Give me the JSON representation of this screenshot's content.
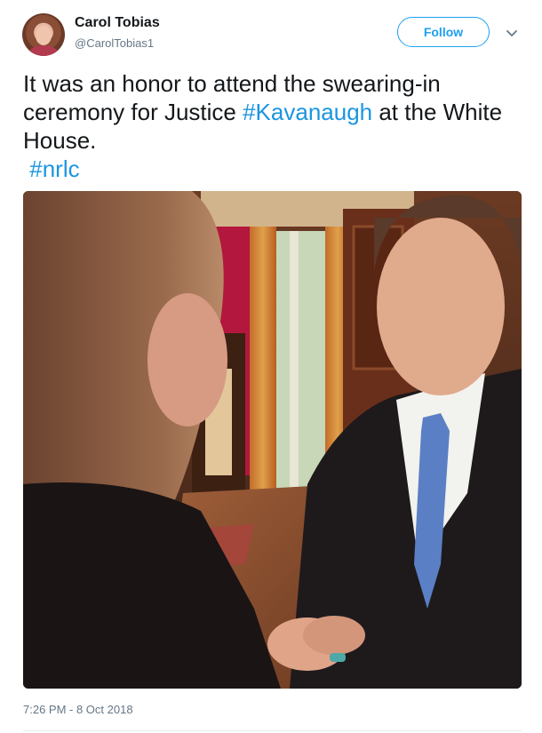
{
  "author": {
    "name": "Carol Tobias",
    "handle": "@CarolTobias1"
  },
  "follow_label": "Follow",
  "tweet": {
    "text_1": "It was an honor to attend the swearing-in ceremony for Justice ",
    "hashtag_1": "#Kavanaugh",
    "text_2": " at the White House.",
    "hashtag_2": "#nrlc"
  },
  "timestamp": "7:26 PM - 8 Oct 2018",
  "colors": {
    "link": "#1b95e0",
    "follow_border": "#1da1f2",
    "meta": "#657786"
  },
  "icons": {
    "menu": "chevron-down-icon"
  }
}
